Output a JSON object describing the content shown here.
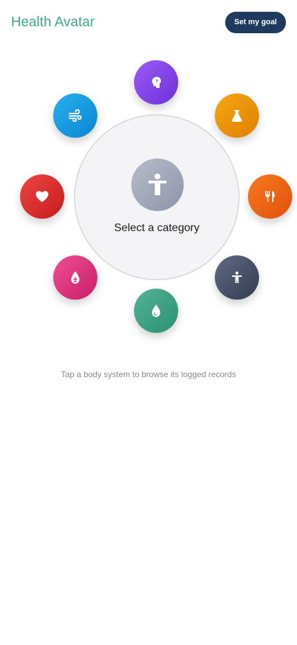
{
  "header": {
    "title": "Health Avatar",
    "goal_button_label": "Set my goal"
  },
  "wheel": {
    "center_label": "Select a category",
    "center_icon": "person-icon",
    "categories": [
      {
        "name": "brain",
        "icon": "brain-icon",
        "color": "#7c3aed"
      },
      {
        "name": "lab",
        "icon": "flask-icon",
        "color": "#f59e0b"
      },
      {
        "name": "nutrition",
        "icon": "fork-knife-icon",
        "color": "#f97316"
      },
      {
        "name": "body",
        "icon": "person-icon",
        "color": "#475569"
      },
      {
        "name": "hydration",
        "icon": "droplet-icon",
        "color": "#3fa88c"
      },
      {
        "name": "blood-sugar",
        "icon": "blood-drop-icon",
        "color": "#db2777"
      },
      {
        "name": "heart",
        "icon": "heart-icon",
        "color": "#dc2626"
      },
      {
        "name": "respiratory",
        "icon": "wind-icon",
        "color": "#0ea5e9"
      }
    ]
  },
  "hint": "Tap a body system to browse its logged records",
  "colors": {
    "brand": "#3fa88c",
    "button": "#1f3a5f"
  }
}
